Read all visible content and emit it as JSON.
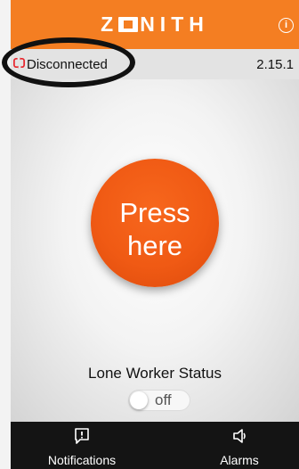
{
  "header": {
    "brand_before": "Z",
    "brand_after": "NITH",
    "info_label": "i"
  },
  "status": {
    "connection_text": "Disconnected",
    "version": "2.15.1"
  },
  "main": {
    "button_line1": "Press",
    "button_line2": "here",
    "lone_worker_label": "Lone Worker Status",
    "toggle_state": "off"
  },
  "nav": {
    "items": [
      {
        "label": "Notifications",
        "icon": "notification-icon"
      },
      {
        "label": "Alarms",
        "icon": "speaker-icon"
      }
    ]
  },
  "colors": {
    "brand": "#f47e22",
    "button": "#f05a14",
    "status_icon": "#e8222a",
    "nav_bg": "#141414"
  }
}
